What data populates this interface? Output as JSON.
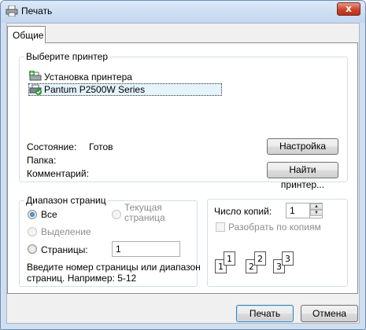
{
  "window": {
    "title": "Печать",
    "close_symbol": "x"
  },
  "tabs": [
    {
      "label": "Общие"
    }
  ],
  "printer_group": {
    "title": "Выберите принтер",
    "printers": [
      {
        "name": "Установка принтера",
        "icon": "add-printer-icon"
      },
      {
        "name": "Pantum P2500W Series",
        "icon": "default-printer-icon",
        "selected": true
      }
    ],
    "status_label": "Состояние:",
    "status_value": "Готов",
    "folder_label": "Папка:",
    "folder_value": "",
    "comment_label": "Комментарий:",
    "comment_value": "",
    "settings_button": "Настройка",
    "find_button": "Найти принтер..."
  },
  "range_group": {
    "title": "Диапазон страниц",
    "options": {
      "all": "Все",
      "current": "Текущая\nстраница",
      "selection": "Выделение",
      "pages": "Страницы:"
    },
    "pages_value": "1",
    "hint": "Введите номер страницы или диапазон\nстраниц.  Например: 5-12"
  },
  "copies_group": {
    "copies_label": "Число копий:",
    "copies_value": "1",
    "collate_label": "Разобрать по копиям",
    "collate_checked": false,
    "preview_pages": [
      "1",
      "1",
      "2",
      "2",
      "3",
      "3"
    ]
  },
  "footer": {
    "print_button": "Печать",
    "cancel_button": "Отмена"
  }
}
